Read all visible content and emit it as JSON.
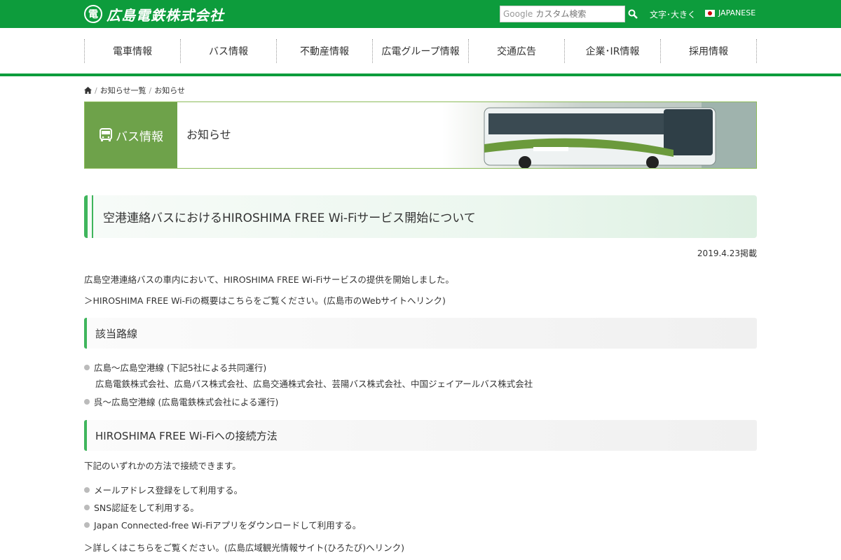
{
  "header": {
    "logo_text": "広島電鉄株式会社",
    "search_brand": "Google",
    "search_placeholder": "カスタム検索",
    "font_size_link": "文字･大きく",
    "language": "JAPANESE",
    "brand_color": "#0d9c3c"
  },
  "nav": {
    "items": [
      "電車情報",
      "バス情報",
      "不動産情報",
      "広電グループ情報",
      "交通広告",
      "企業･IR情報",
      "採用情報"
    ]
  },
  "breadcrumb": {
    "items": [
      "お知らせ一覧",
      "お知らせ"
    ]
  },
  "banner": {
    "category": "バス情報",
    "title": "お知らせ"
  },
  "article": {
    "title": "空港連絡バスにおけるHIROSHIMA FREE Wi-Fiサービス開始について",
    "date": "2019.4.23掲載",
    "intro": "広島空港連絡バスの車内において、HIROSHIMA FREE Wi-Fiサービスの提供を開始しました。",
    "overview_link": "HIROSHIMA FREE Wi-Fiの概要はこちらをご覧ください。(広島市のWebサイトへリンク)",
    "routes_heading": "該当路線",
    "routes": [
      {
        "name": "広島～広島空港線 (下記5社による共同運行)",
        "detail": "広島電鉄株式会社、広島バス株式会社、広島交通株式会社、芸陽バス株式会社、中国ジェイアールバス株式会社"
      },
      {
        "name": "呉～広島空港線 (広島電鉄株式会社による運行)",
        "detail": ""
      }
    ],
    "connect_heading": "HIROSHIMA FREE Wi-Fiへの接続方法",
    "connect_intro": "下記のいずれかの方法で接続できます。",
    "methods": [
      "メールアドレス登録をして利用する。",
      "SNS認証をして利用する。",
      "Japan Connected-free Wi-Fiアプリをダウンロードして利用する。"
    ],
    "detail_link": "詳しくはこちらをご覧ください。(広島広域観光情報サイト(ひろたび)へリンク)"
  }
}
